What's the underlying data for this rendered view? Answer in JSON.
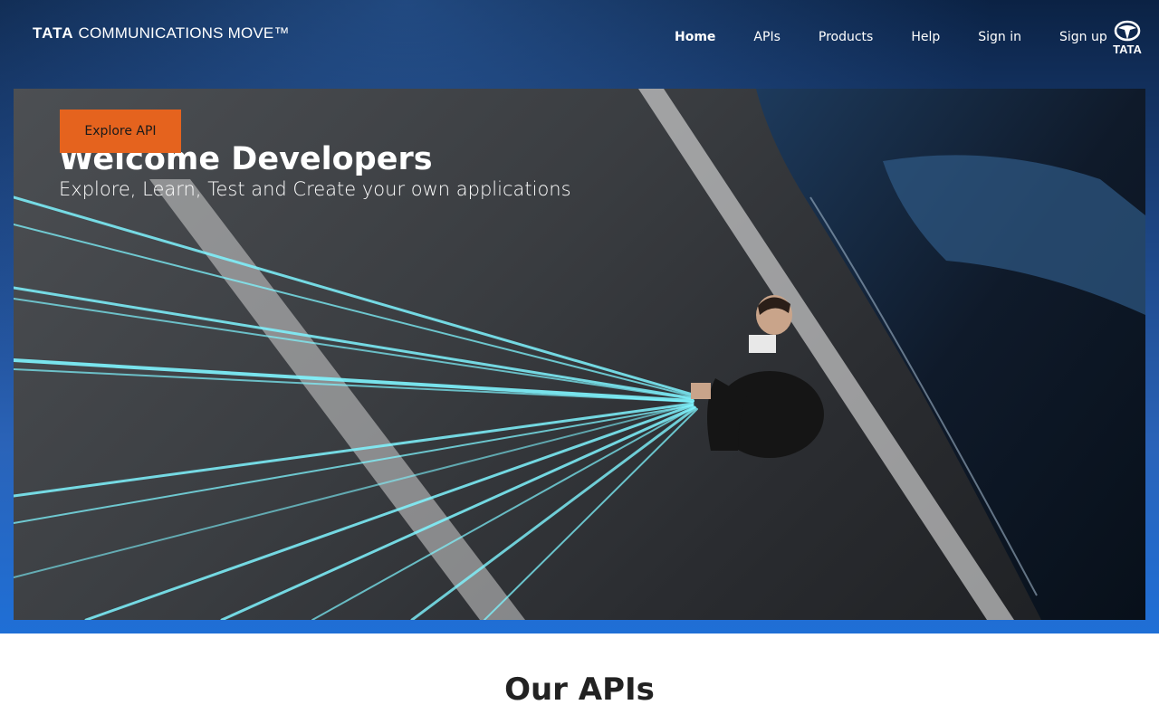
{
  "header": {
    "logo_bold": "TATA",
    "logo_text": "COMMUNICATIONS MOVE™",
    "nav": [
      {
        "label": "Home",
        "active": true
      },
      {
        "label": "APIs",
        "active": false
      },
      {
        "label": "Products",
        "active": false
      },
      {
        "label": "Help",
        "active": false
      },
      {
        "label": "Sign in",
        "active": false
      },
      {
        "label": "Sign up",
        "active": false
      }
    ],
    "brand_mark_text": "TATA"
  },
  "hero": {
    "cta_label": "Explore API",
    "title": "Welcome Developers",
    "subtitle": "Explore, Learn, Test and Create your own applications",
    "image_icon": "hero-photo-person-with-light-streams"
  },
  "main": {
    "section_title": "Our APIs"
  },
  "colors": {
    "banner_top": "#0b2244",
    "banner_bottom": "#1f6fd6",
    "cta": "#e5631e",
    "light_stream": "#7ff5ff"
  }
}
